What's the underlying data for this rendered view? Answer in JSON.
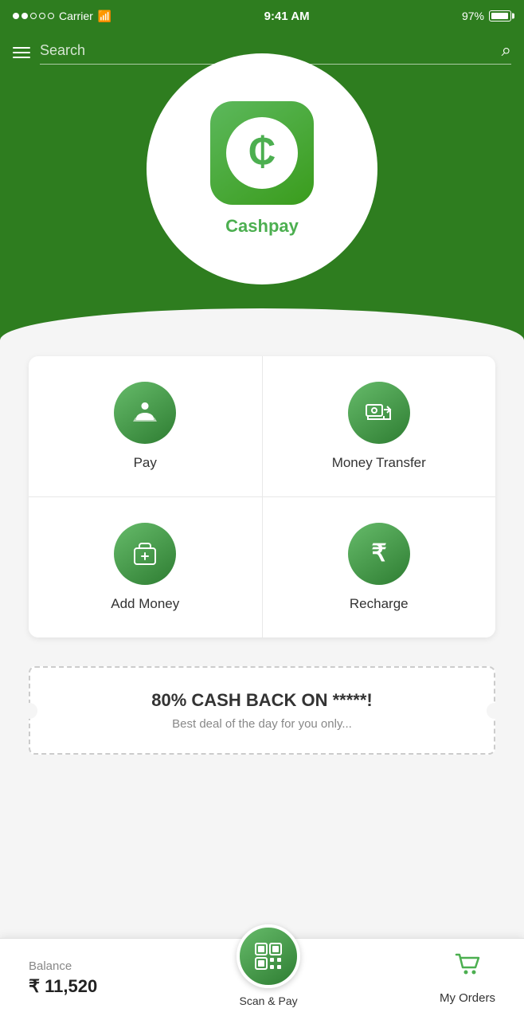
{
  "status_bar": {
    "carrier": "Carrier",
    "time": "9:41 AM",
    "battery": "97%"
  },
  "search": {
    "placeholder": "Search",
    "icon": "🔍"
  },
  "hero": {
    "app_name": "Cashpay"
  },
  "grid": {
    "items": [
      {
        "id": "pay",
        "label": "Pay",
        "icon": "💵"
      },
      {
        "id": "money-transfer",
        "label": "Money Transfer",
        "icon": "🏦"
      },
      {
        "id": "add-money",
        "label": "Add Money",
        "icon": "👜"
      },
      {
        "id": "recharge",
        "label": "Recharge",
        "icon": "₹"
      }
    ]
  },
  "banner": {
    "title": "80% CASH BACK ON *****!",
    "subtitle": "Best deal of the day for you only..."
  },
  "bottom_bar": {
    "balance_label": "Balance",
    "balance_amount": "₹ 11,520",
    "scan_label": "Scan & Pay",
    "orders_label": "My Orders"
  }
}
